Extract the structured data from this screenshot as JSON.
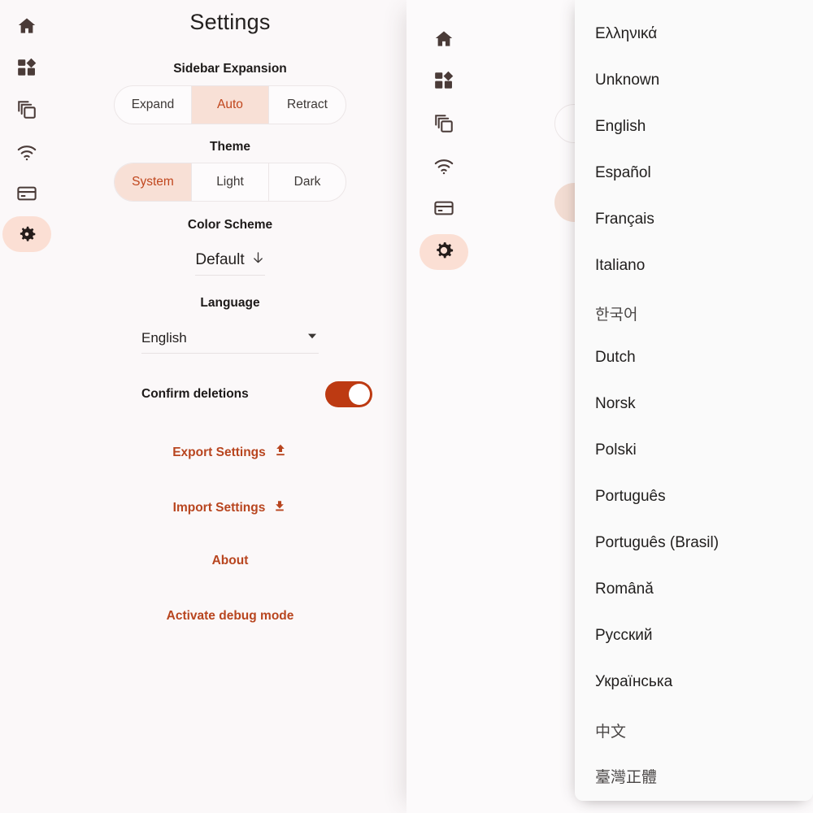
{
  "app": {
    "background": "#fbf8f9",
    "accent": "#b8451f",
    "accent_soft": "#f8e0d6",
    "rail_active_bg": "#fbdfd4",
    "toggle_on": "#bd3a12"
  },
  "sidebar": {
    "items": [
      {
        "name": "home-icon",
        "label": "Home",
        "active": false
      },
      {
        "name": "dashboard-icon",
        "label": "Dashboard",
        "active": false
      },
      {
        "name": "layers-icon",
        "label": "Layers",
        "active": false
      },
      {
        "name": "wifi-icon",
        "label": "Wi-Fi",
        "active": false
      },
      {
        "name": "card-icon",
        "label": "Card",
        "active": false
      },
      {
        "name": "gear-icon",
        "label": "Settings",
        "active": true
      }
    ]
  },
  "settings": {
    "title": "Settings",
    "sections": {
      "sidebar_expansion": {
        "label": "Sidebar Expansion",
        "options": [
          "Expand",
          "Auto",
          "Retract"
        ],
        "selected": "Auto"
      },
      "theme": {
        "label": "Theme",
        "options": [
          "System",
          "Light",
          "Dark"
        ],
        "selected": "System"
      },
      "color_scheme": {
        "label": "Color Scheme",
        "value": "Default",
        "icon": "arrow-down-icon"
      },
      "language": {
        "label": "Language",
        "value": "English",
        "icon": "chevron-down-icon"
      }
    },
    "confirm_deletions": {
      "label": "Confirm deletions",
      "state": "on"
    },
    "actions": [
      {
        "label": "Export Settings",
        "icon": "upload-icon",
        "name": "export-settings-button"
      },
      {
        "label": "Import Settings",
        "icon": "download-icon",
        "name": "import-settings-button"
      },
      {
        "label": "About",
        "icon": null,
        "name": "about-button"
      },
      {
        "label": "Activate debug mode",
        "icon": null,
        "name": "activate-debug-mode-button"
      }
    ]
  },
  "language_dropdown": {
    "items": [
      "Ελληνικά",
      "Unknown",
      "English",
      "Español",
      "Français",
      "Italiano",
      "한국어",
      "Dutch",
      "Norsk",
      "Polski",
      "Português",
      "Português (Brasil)",
      "Română",
      "Русский",
      "Українська",
      "中文",
      "臺灣正體"
    ]
  }
}
